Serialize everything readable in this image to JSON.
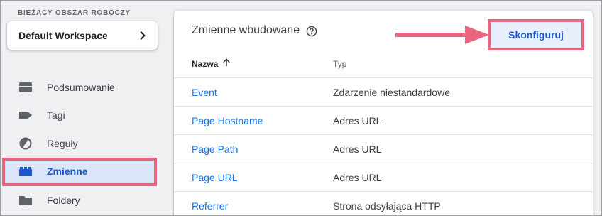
{
  "sidebar": {
    "workspace_label": "BIEŻĄCY OBSZAR ROBOCZY",
    "workspace_name": "Default Workspace",
    "items": [
      {
        "label": "Podsumowanie",
        "icon": "briefcase-icon"
      },
      {
        "label": "Tagi",
        "icon": "tag-icon"
      },
      {
        "label": "Reguły",
        "icon": "trigger-icon"
      },
      {
        "label": "Zmienne",
        "icon": "variables-icon",
        "active": true
      },
      {
        "label": "Foldery",
        "icon": "folder-icon"
      }
    ]
  },
  "main": {
    "title": "Zmienne wbudowane",
    "configure_label": "Skonfiguruj",
    "columns": {
      "name": "Nazwa",
      "type": "Typ"
    },
    "rows": [
      {
        "name": "Event",
        "type": "Zdarzenie niestandardowe"
      },
      {
        "name": "Page Hostname",
        "type": "Adres URL"
      },
      {
        "name": "Page Path",
        "type": "Adres URL"
      },
      {
        "name": "Page URL",
        "type": "Adres URL"
      },
      {
        "name": "Referrer",
        "type": "Strona odsyłająca HTTP"
      }
    ]
  },
  "colors": {
    "accent": "#1a73e8",
    "highlight_border": "#e8667d",
    "active_bg": "#dae6f8"
  }
}
